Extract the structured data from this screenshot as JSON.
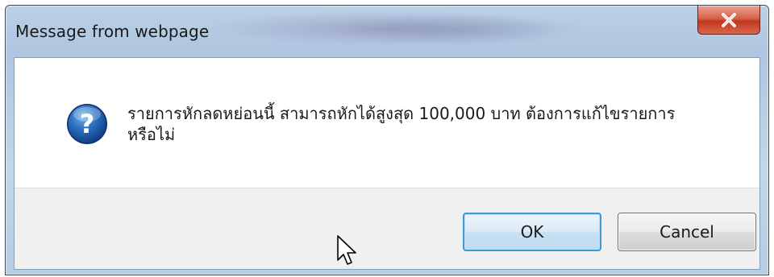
{
  "dialog": {
    "title": "Message from webpage",
    "message_line1": "รายการหักลดหย่อนนี้ สามารถหักได้สูงสุด 100,000 บาท ต้องการแก้ไขรายการ",
    "message_line2": "หรือไม่",
    "icon": "question-icon",
    "ok_label": "OK",
    "cancel_label": "Cancel",
    "close_icon": "close-icon"
  },
  "colors": {
    "close_button": "#c8462c",
    "ok_border": "#3c9ad6",
    "question_icon": "#1f5fa8"
  }
}
